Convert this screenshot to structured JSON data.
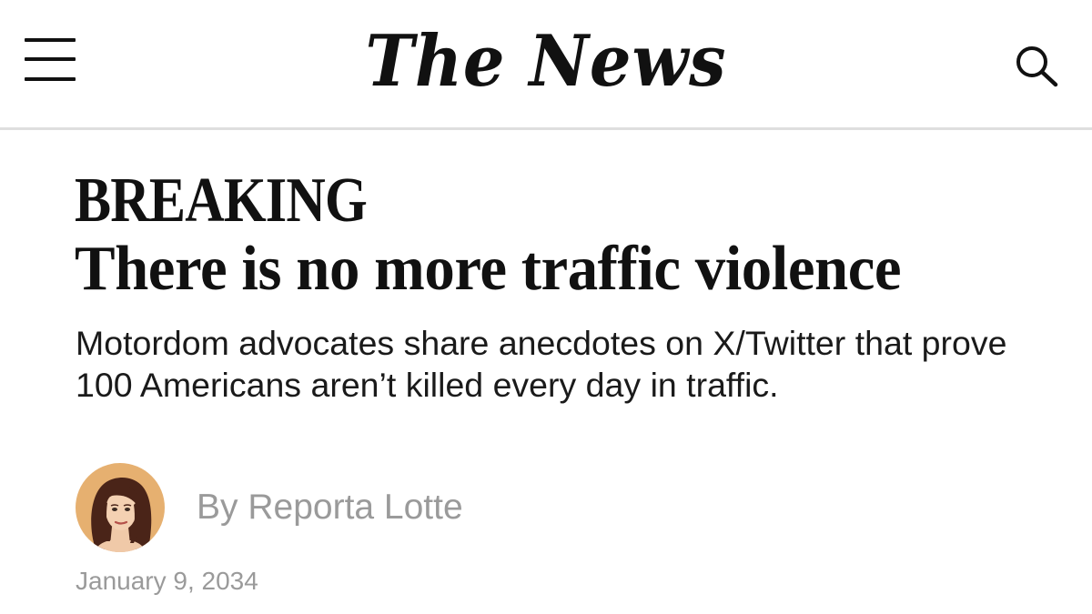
{
  "header": {
    "logo_text": "The News",
    "menu_icon": "hamburger-menu-icon",
    "search_icon": "search-icon"
  },
  "article": {
    "kicker": "BREAKING",
    "headline": "There is no more traffic violence",
    "dek": "Motordom advocates share anecdotes on X/Twitter that prove 100 Americans aren’t killed every day in traffic.",
    "byline": "By Reporta Lotte",
    "author_avatar_icon": "author-avatar",
    "date": "January 9, 2034"
  },
  "colors": {
    "text": "#111111",
    "muted": "#9a9a9a",
    "divider": "#dedede",
    "avatar_bg": "#e6b070"
  }
}
